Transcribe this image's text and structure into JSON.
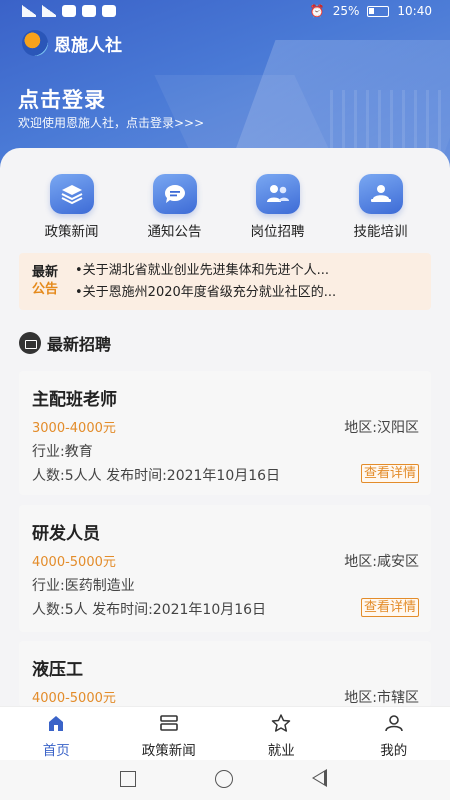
{
  "status_bar": {
    "battery": "25%",
    "time": "10:40"
  },
  "brand": {
    "name": "恩施人社"
  },
  "login": {
    "title": "点击登录",
    "subtitle": "欢迎使用恩施人社，点击登录>>>"
  },
  "quick_links": [
    {
      "label": "政策新闻",
      "icon": "layers-icon"
    },
    {
      "label": "通知公告",
      "icon": "chat-bubble-icon"
    },
    {
      "label": "岗位招聘",
      "icon": "people-icon"
    },
    {
      "label": "技能培训",
      "icon": "training-icon"
    }
  ],
  "notice": {
    "tag_line1": "最新",
    "tag_line2": "公告",
    "items": [
      "•关于湖北省就业创业先进集体和先进个人...",
      "•关于恩施州2020年度省级充分就业社区的..."
    ]
  },
  "section": {
    "title": "最新招聘"
  },
  "jobs": [
    {
      "title": "主配班老师",
      "salary": "3000-4000元",
      "region": "地区:汉阳区",
      "industry": "行业:教育",
      "meta": "人数:5人人  发布时间:2021年10月16日",
      "detail": "查看详情"
    },
    {
      "title": "研发人员",
      "salary": "4000-5000元",
      "region": "地区:咸安区",
      "industry": "行业:医药制造业",
      "meta": "人数:5人   发布时间:2021年10月16日",
      "detail": "查看详情"
    },
    {
      "title": "液压工",
      "salary": "4000-5000元",
      "region": "地区:市辖区",
      "industry": "",
      "meta": "",
      "detail": ""
    }
  ],
  "tabbar": [
    {
      "label": "首页",
      "icon": "home-icon",
      "active": true
    },
    {
      "label": "政策新闻",
      "icon": "news-icon"
    },
    {
      "label": "就业",
      "icon": "star-icon"
    },
    {
      "label": "我的",
      "icon": "person-icon"
    }
  ],
  "colors": {
    "primary": "#3a63c8",
    "accent": "#e38c2a",
    "notice_bg": "#fbeee3"
  }
}
